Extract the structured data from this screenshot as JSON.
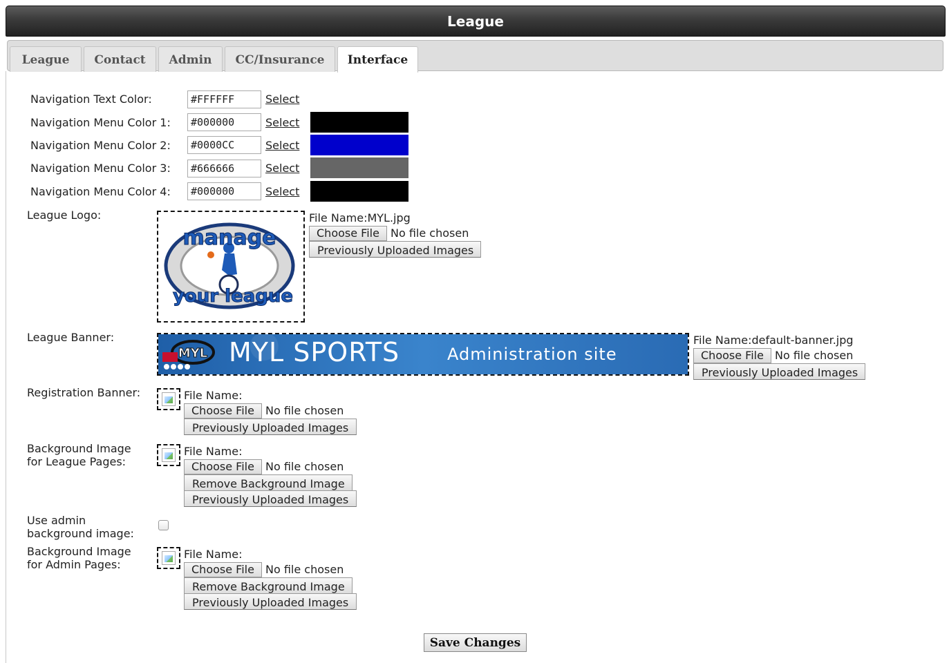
{
  "window": {
    "title": "League"
  },
  "tabs": [
    {
      "label": "League"
    },
    {
      "label": "Contact"
    },
    {
      "label": "Admin"
    },
    {
      "label": "CC/Insurance"
    },
    {
      "label": "Interface",
      "active": true
    }
  ],
  "nav_colors": [
    {
      "label": "Navigation Text Color:",
      "value": "#FFFFFF",
      "select_label": "Select",
      "swatch": null
    },
    {
      "label": "Navigation Menu Color 1:",
      "value": "#000000",
      "select_label": "Select",
      "swatch": "#000000"
    },
    {
      "label": "Navigation Menu Color 2:",
      "value": "#0000CC",
      "select_label": "Select",
      "swatch": "#0000CC"
    },
    {
      "label": "Navigation Menu Color 3:",
      "value": "#666666",
      "select_label": "Select",
      "swatch": "#666666"
    },
    {
      "label": "Navigation Menu Color 4:",
      "value": "#000000",
      "select_label": "Select",
      "swatch": "#000000"
    }
  ],
  "logo": {
    "label": "League Logo:",
    "file_name": "File Name:MYL.jpg",
    "choose_label": "Choose File",
    "no_file": "No file chosen",
    "prev_label": "Previously Uploaded Images",
    "image_text_top": "manage",
    "image_text_bottom": "your league"
  },
  "banner": {
    "label": "League Banner:",
    "file_name": "File Name:default-banner.jpg",
    "choose_label": "Choose File",
    "no_file": "No file chosen",
    "prev_label": "Previously Uploaded Images",
    "image_badge": "MYL",
    "image_title": "MYL SPORTS",
    "image_subtitle": "Administration site"
  },
  "reg_banner": {
    "label": "Registration Banner:",
    "file_name": "File Name:",
    "choose_label": "Choose File",
    "no_file": "No file chosen",
    "prev_label": "Previously Uploaded Images"
  },
  "bg_league": {
    "label_line1": "Background Image",
    "label_line2": "for League Pages:",
    "file_name": "File Name:",
    "choose_label": "Choose File",
    "no_file": "No file chosen",
    "remove_label": "Remove Background Image",
    "prev_label": "Previously Uploaded Images"
  },
  "use_admin_bg": {
    "label_line1": "Use admin",
    "label_line2": "background image:",
    "checked": false
  },
  "bg_admin": {
    "label_line1": "Background Image",
    "label_line2": "for Admin Pages:",
    "file_name": "File Name:",
    "choose_label": "Choose File",
    "no_file": "No file chosen",
    "remove_label": "Remove Background Image",
    "prev_label": "Previously Uploaded Images"
  },
  "save_label": "Save Changes"
}
